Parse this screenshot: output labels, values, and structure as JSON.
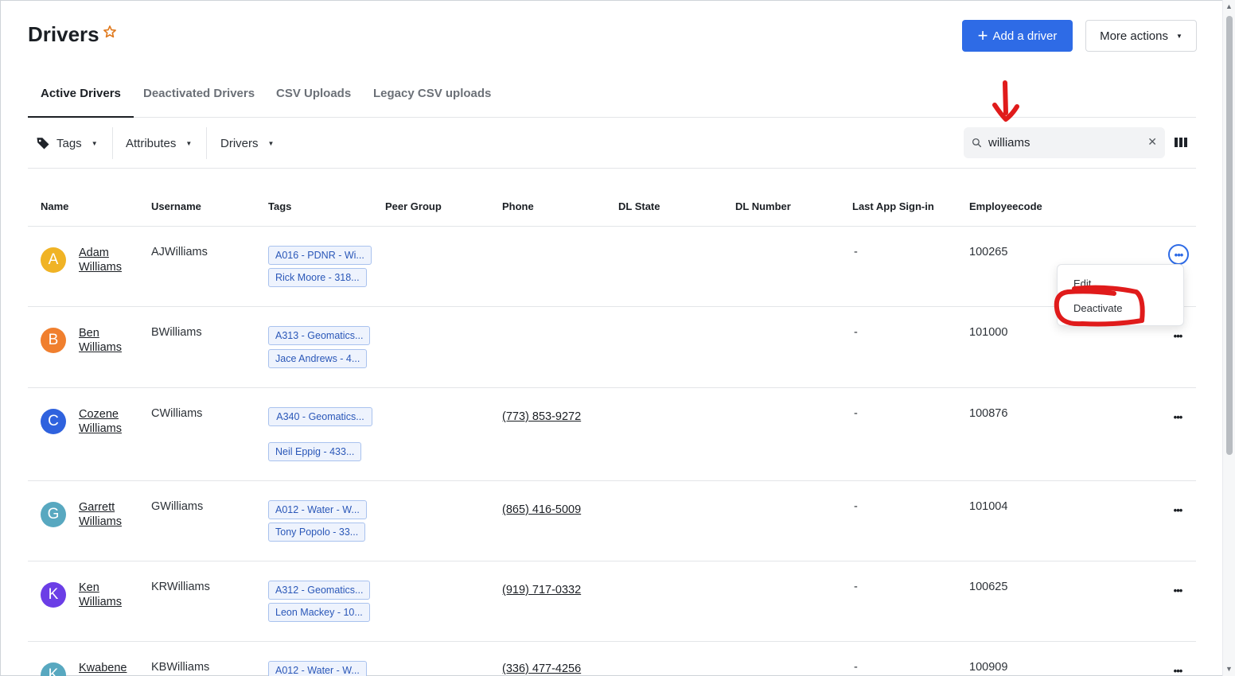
{
  "header": {
    "title": "Drivers",
    "add_button": "Add a driver",
    "more_actions": "More actions"
  },
  "tabs": [
    {
      "label": "Active Drivers",
      "active": true
    },
    {
      "label": "Deactivated Drivers"
    },
    {
      "label": "CSV Uploads"
    },
    {
      "label": "Legacy CSV uploads"
    }
  ],
  "filters": {
    "tags": "Tags",
    "attributes": "Attributes",
    "drivers": "Drivers"
  },
  "search": {
    "value": "williams"
  },
  "columns": [
    "Name",
    "Username",
    "Tags",
    "Peer Group",
    "Phone",
    "DL State",
    "DL Number",
    "Last App Sign-in",
    "Employeecode"
  ],
  "rows": [
    {
      "initial": "A",
      "first": "Adam",
      "last": "Williams",
      "username": "AJWilliams",
      "tags": [
        "A016 - PDNR - Wi...",
        "Rick Moore - 318..."
      ],
      "phone": "",
      "signin": "-",
      "code": "100265",
      "avatar_color": "#f0b325"
    },
    {
      "initial": "B",
      "first": "Ben",
      "last": "Williams",
      "username": "BWilliams",
      "tags": [
        "A313 - Geomatics...",
        "Jace Andrews - 4..."
      ],
      "phone": "",
      "signin": "-",
      "code": "101000",
      "avatar_color": "#f07f2e"
    },
    {
      "initial": "C",
      "first": "Cozene",
      "last": "Williams",
      "username": "CWilliams",
      "tags": [
        "A340 - Geomatics...",
        "Neil Eppig - 433..."
      ],
      "phone": "(773) 853-9272",
      "signin": "-",
      "code": "100876",
      "avatar_color": "#2f62de"
    },
    {
      "initial": "G",
      "first": "Garrett",
      "last": "Williams",
      "username": "GWilliams",
      "tags": [
        "A012 - Water - W...",
        "Tony Popolo - 33..."
      ],
      "phone": "(865) 416-5009",
      "signin": "-",
      "code": "101004",
      "avatar_color": "#58a8c0"
    },
    {
      "initial": "K",
      "first": "Ken",
      "last": "Williams",
      "username": "KRWilliams",
      "tags": [
        "A312 - Geomatics...",
        "Leon Mackey - 10..."
      ],
      "phone": "(919) 717-0332",
      "signin": "-",
      "code": "100625",
      "avatar_color": "#6b3ee6"
    },
    {
      "initial": "K",
      "first": "Kwabene",
      "last": "",
      "username": "KBWilliams",
      "tags": [
        "A012 - Water - W..."
      ],
      "phone": "(336) 477-4256",
      "signin": "-",
      "code": "100909",
      "avatar_color": "#58a8c0"
    }
  ],
  "row_menu": {
    "edit": "Edit",
    "deactivate": "Deactivate"
  },
  "colors": {
    "primary": "#2e6be6",
    "annotation": "#e01b1b"
  }
}
